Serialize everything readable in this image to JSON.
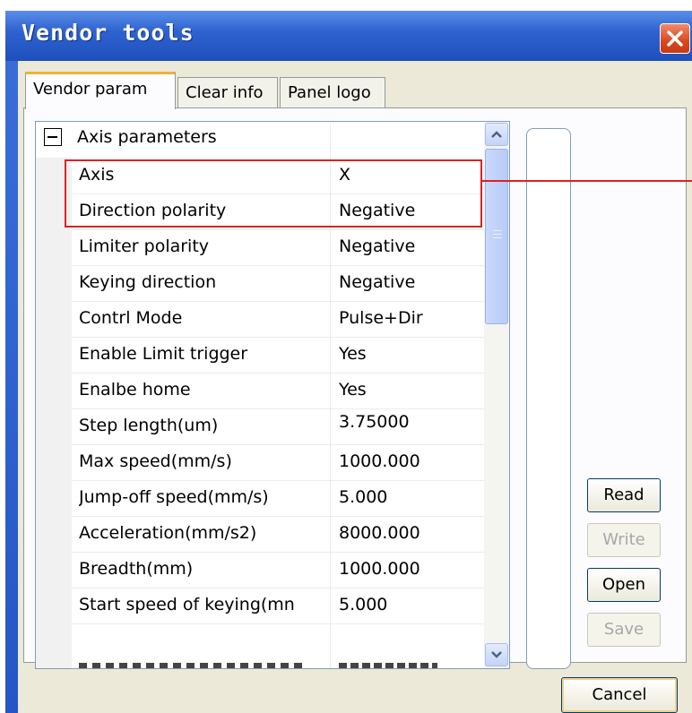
{
  "window": {
    "title": "Vendor tools",
    "close_label": "close"
  },
  "tabs": [
    {
      "label": "Vendor param",
      "active": true
    },
    {
      "label": "Clear info",
      "active": false
    },
    {
      "label": "Panel logo",
      "active": false
    }
  ],
  "grid": {
    "category": "Axis parameters",
    "rows": [
      {
        "name": "Axis",
        "value": "X"
      },
      {
        "name": "Direction polarity",
        "value": "Negative"
      },
      {
        "name": "Limiter polarity",
        "value": "Negative"
      },
      {
        "name": "Keying direction",
        "value": "Negative"
      },
      {
        "name": "Contrl Mode",
        "value": "Pulse+Dir"
      },
      {
        "name": "Enable Limit trigger",
        "value": "Yes"
      },
      {
        "name": "Enalbe home",
        "value": "Yes"
      },
      {
        "name": "Step length(um)",
        "value": "3.75000"
      },
      {
        "name": "Max speed(mm/s)",
        "value": "1000.000"
      },
      {
        "name": "Jump-off speed(mm/s)",
        "value": "5.000"
      },
      {
        "name": "Acceleration(mm/s2)",
        "value": "8000.000"
      },
      {
        "name": "Breadth(mm)",
        "value": "1000.000"
      },
      {
        "name": "Start speed of keying(mn",
        "value": "5.000"
      }
    ]
  },
  "buttons": {
    "read": "Read",
    "write": "Write",
    "open": "Open",
    "save": "Save",
    "cancel": "Cancel"
  },
  "colors": {
    "title_bar": "#2f63d0",
    "highlight": "#e02020",
    "dialog_bg": "#ece9d8"
  }
}
